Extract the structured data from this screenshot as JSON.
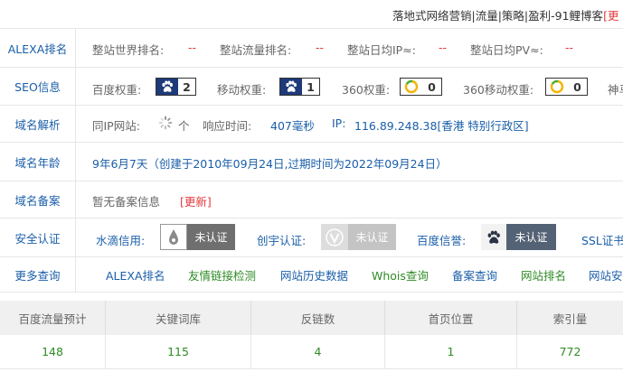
{
  "top_line": {
    "text": "落地式网络营销|流量|策略|盈利-91鲤博客",
    "update_label": "[更"
  },
  "alexa": {
    "label": "ALEXA排名",
    "world_rank_label": "整站世界排名:",
    "world_rank_value": "--",
    "traffic_rank_label": "整站流量排名:",
    "traffic_rank_value": "--",
    "daily_ip_label": "整站日均IP≈:",
    "daily_ip_value": "--",
    "daily_pv_label": "整站日均PV≈:",
    "daily_pv_value": "--"
  },
  "seo": {
    "label": "SEO信息",
    "baidu_weight_label": "百度权重:",
    "baidu_weight_value": "2",
    "mobile_weight_label": "移动权重:",
    "mobile_weight_value": "1",
    "w360_label": "360权重:",
    "w360_value": "0",
    "w360_mobile_label": "360移动权重:",
    "w360_mobile_value": "0",
    "shenma_label": "神马"
  },
  "dns": {
    "label": "域名解析",
    "same_ip_label": "同IP网站:",
    "same_ip_unit": "个",
    "response_label": "响应时间:",
    "response_value": "407毫秒",
    "ip_label": "IP:",
    "ip_value": "116.89.248.38[香港 特别行政区]"
  },
  "age": {
    "label": "域名年龄",
    "value": "9年6月7天（创建于2010年09月24日,过期时间为2022年09月24日）"
  },
  "icp": {
    "label": "域名备案",
    "value": "暂无备案信息",
    "update": "[更新]"
  },
  "security": {
    "label": "安全认证",
    "shuidi_label": "水滴信用:",
    "shuidi_badge": "未认证",
    "chuangyu_label": "创宇认证:",
    "chuangyu_badge": "未认证",
    "baidu_label": "百度信誉:",
    "baidu_badge": "未认证",
    "ssl_label": "SSL证书"
  },
  "more": {
    "label": "更多查询",
    "links": [
      "ALEXA排名",
      "友情链接检测",
      "网站历史数据",
      "Whois查询",
      "备案查询",
      "网站排名",
      "网站安"
    ]
  },
  "stats": {
    "headers": [
      "百度流量预计",
      "关键词库",
      "反链数",
      "首页位置",
      "索引量"
    ],
    "values": [
      "148",
      "115",
      "4",
      "1",
      "772"
    ]
  },
  "colors": {
    "label_blue": "#1a5ea8",
    "link_green": "#2e8b24",
    "red": "#e4393c",
    "badge_navy": "#1e3a7a"
  }
}
